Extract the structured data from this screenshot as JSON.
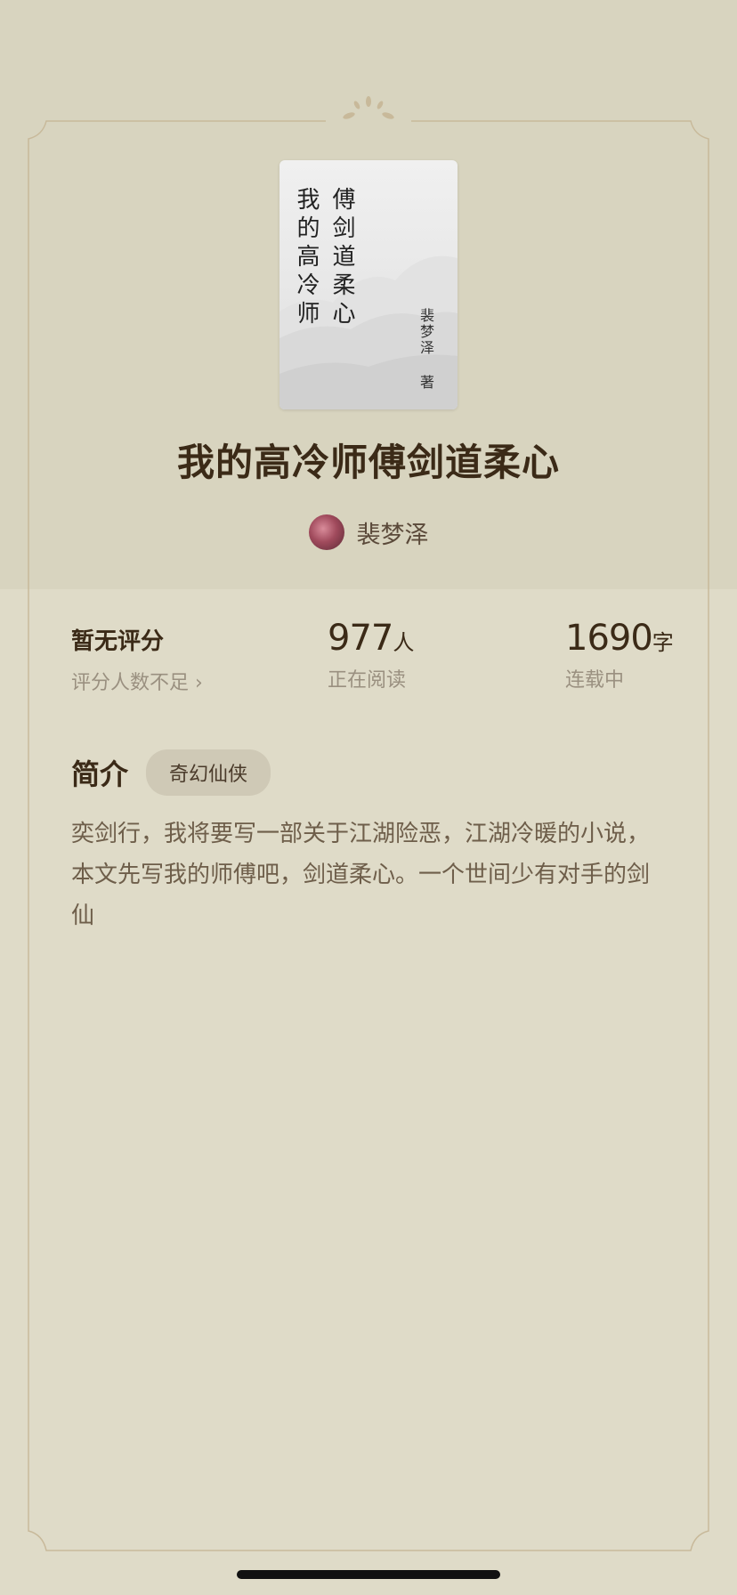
{
  "book": {
    "title": "我的高冷师傅剑道柔心",
    "cover_title_vertical": "傅剑道柔心\n我的高冷师",
    "cover_author": "裴梦泽 著",
    "author": "裴梦泽"
  },
  "stats": {
    "rating": {
      "title": "暂无评分",
      "subtitle": "评分人数不足 ›"
    },
    "readers": {
      "value": "977",
      "unit": "人",
      "subtitle": "正在阅读"
    },
    "words": {
      "value": "1690",
      "unit": "字",
      "subtitle": "连载中"
    }
  },
  "intro": {
    "heading": "简介",
    "tag": "奇幻仙侠",
    "text": "奕剑行，我将要写一部关于江湖险恶，江湖冷暖的小说，本文先写我的师傅吧，剑道柔心。一个世间少有对手的剑仙"
  },
  "colors": {
    "background": "#dfdbc8",
    "top_band": "#d8d4bf",
    "title": "#3b2a17",
    "frame": "#c8b99a"
  }
}
